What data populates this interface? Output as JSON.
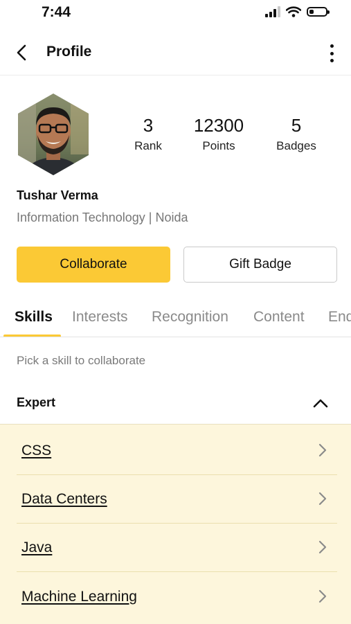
{
  "status_bar": {
    "time": "7:44",
    "icons": [
      "signal-icon",
      "wifi-icon",
      "battery-icon"
    ]
  },
  "header": {
    "title": "Profile",
    "back_icon": "chevron-left-icon",
    "menu_icon": "more-vertical-icon"
  },
  "profile": {
    "name": "Tushar Verma",
    "subtitle": "Information Technology |  Noida",
    "stats": [
      {
        "value": "3",
        "label": "Rank"
      },
      {
        "value": "12300",
        "label": "Points"
      },
      {
        "value": "5",
        "label": "Badges"
      }
    ]
  },
  "actions": {
    "collaborate": "Collaborate",
    "gift_badge": "Gift Badge"
  },
  "tabs": [
    {
      "label": "Skills",
      "active": true
    },
    {
      "label": "Interests"
    },
    {
      "label": "Recognition"
    },
    {
      "label": "Content"
    },
    {
      "label": "Endorsements"
    }
  ],
  "skills": {
    "hint": "Pick a skill to collaborate",
    "section_title": "Expert",
    "items": [
      "CSS",
      "Data Centers",
      "Java",
      "Machine Learning"
    ]
  },
  "colors": {
    "accent": "#fbc935",
    "list_background": "#fdf6dc"
  }
}
